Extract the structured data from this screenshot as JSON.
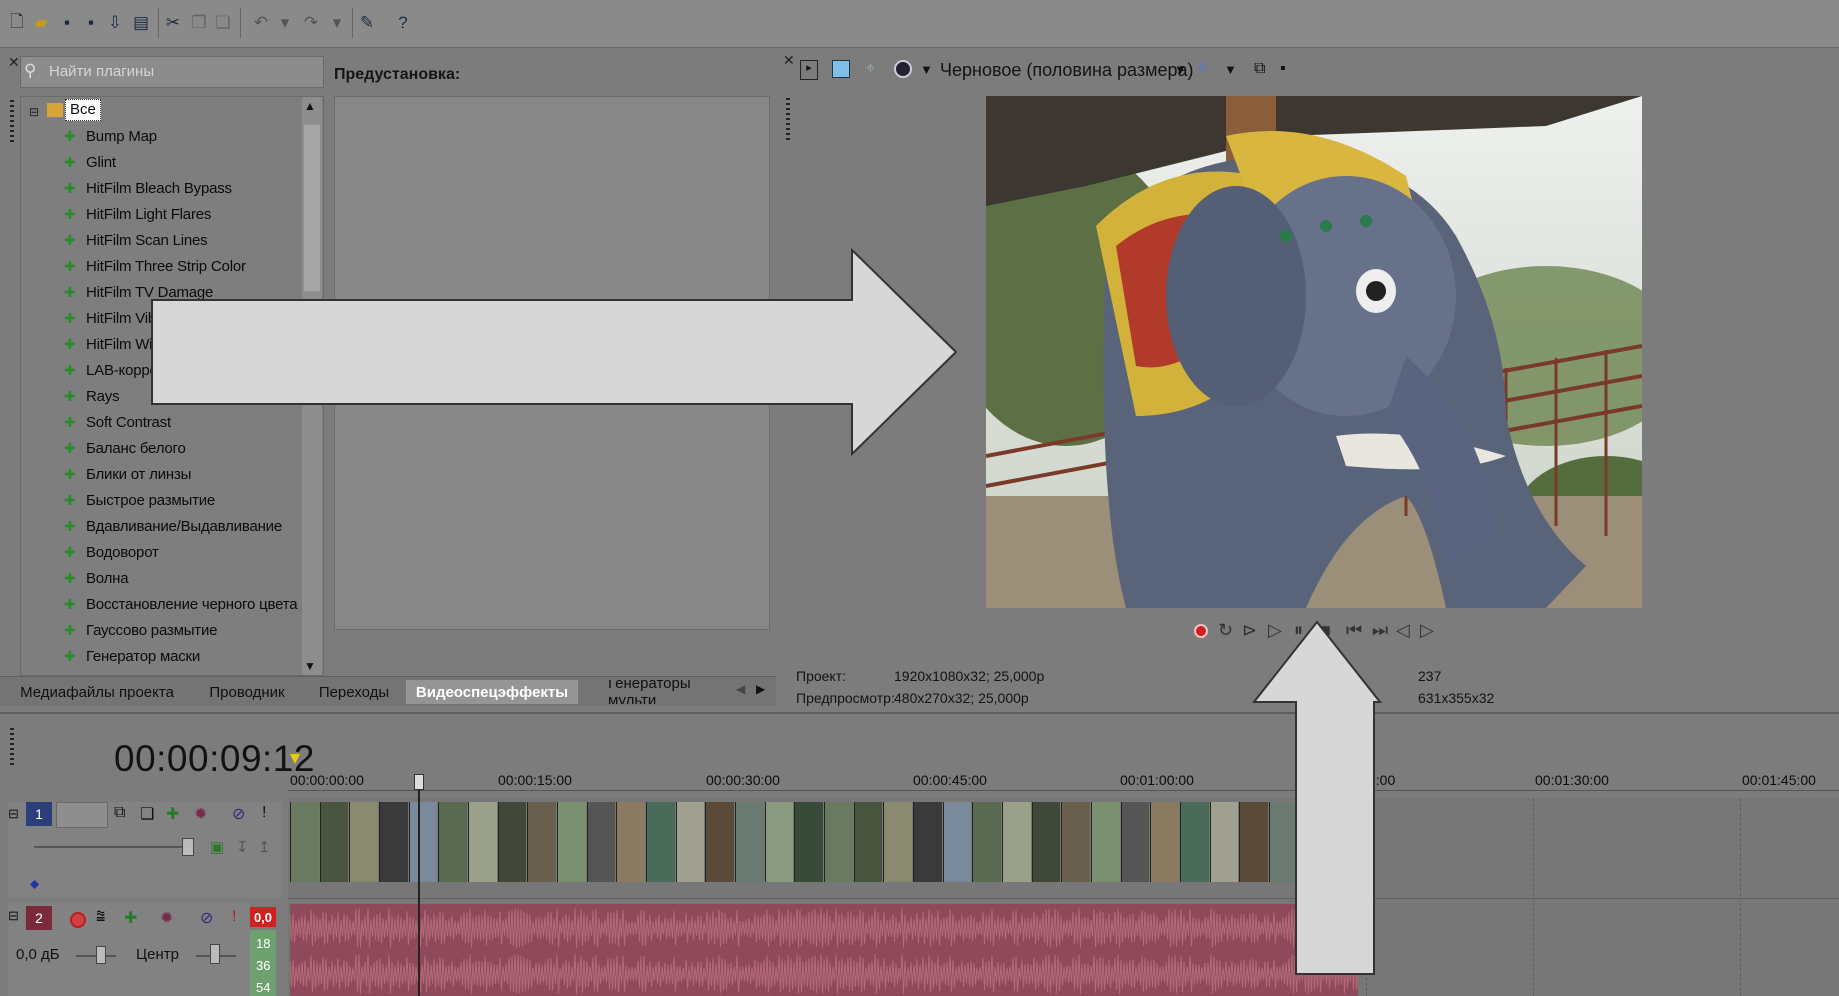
{
  "toolbar": {
    "icons": [
      "new-file-icon",
      "open-folder-icon",
      "save-icon",
      "save-as-icon",
      "render-icon",
      "properties-icon",
      "cut-icon",
      "copy-icon",
      "paste-icon",
      "undo-icon",
      "redo-icon",
      "enable-snapping-icon",
      "help-icon"
    ]
  },
  "plugins": {
    "search_placeholder": "Найти плагины",
    "preset_label": "Предустановка:",
    "root": "Все",
    "items": [
      "Bump Map",
      "Glint",
      "HitFilm Bleach Bypass",
      "HitFilm Light Flares",
      "HitFilm Scan Lines",
      "HitFilm Three Strip Color",
      "HitFilm TV Damage",
      "HitFilm Vibr",
      "HitFilm Witr",
      "LAB-корре",
      "Rays",
      "Soft Contrast",
      "Баланс белого",
      "Блики от линзы",
      "Быстрое размытие",
      "Вдавливание/Выдавливание",
      "Водоворот",
      "Волна",
      "Восстановление черного цвета",
      "Гауссово размытие",
      "Генератор маски"
    ]
  },
  "tabs": [
    "Медиафайлы проекта",
    "Проводник",
    "Переходы",
    "Видеоспецэффекты",
    "Генераторы мульти"
  ],
  "preview": {
    "quality": "Черновое (половина размера)",
    "project_label": "Проект:",
    "project_value": "1920x1080x32; 25,000p",
    "preview_label": "Предпросмотр:",
    "preview_value": "480x270x32; 25,000p",
    "frame_value": "237",
    "display_value": "631x355x32"
  },
  "timeline": {
    "timecode": "00:00:09:12",
    "ruler": [
      "00:00:00:00",
      "00:00:15:00",
      "00:00:30:00",
      "00:00:45:00",
      "00:01:00:00",
      "5:00",
      "00:01:30:00",
      "00:01:45:00"
    ],
    "video_track_num": "1",
    "audio_track_num": "2",
    "audio_level": "0,0",
    "volume_label": "0,0 дБ",
    "pan_label": "Центр",
    "meter_values": [
      "18",
      "36",
      "54"
    ],
    "audio_color": "#8e4a5a",
    "meter_color": "#d02020"
  }
}
